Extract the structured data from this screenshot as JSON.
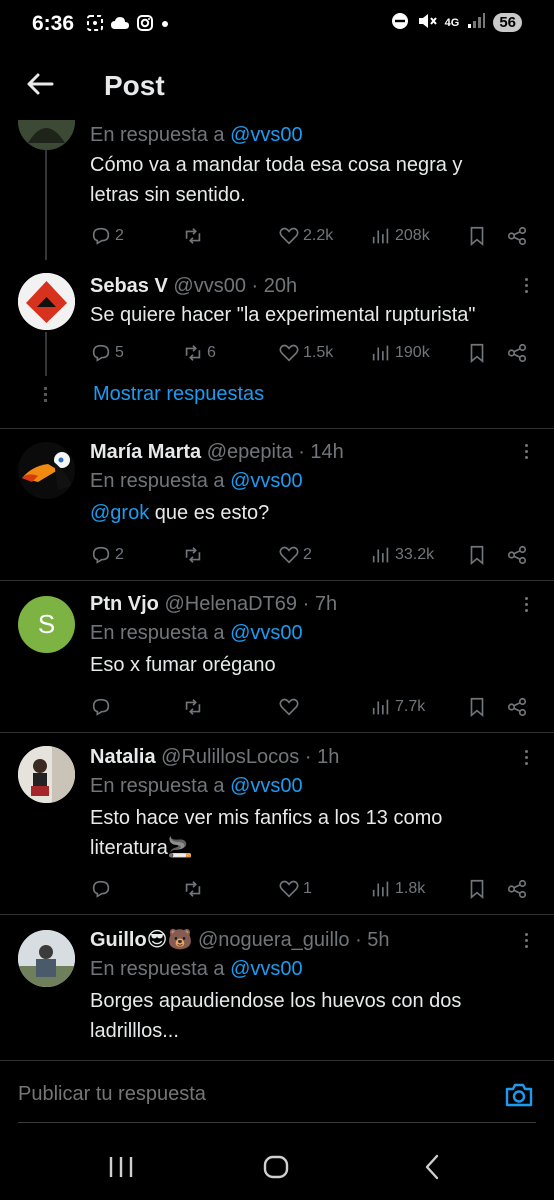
{
  "status_bar": {
    "time": "6:36",
    "network": "4G",
    "battery": "56"
  },
  "header": {
    "title": "Post"
  },
  "colors": {
    "background": "#000000",
    "text": "#e7e9ea",
    "muted": "#71767b",
    "accent": "#1d9bf0"
  },
  "tweets": [
    {
      "name": "",
      "handle": "",
      "time": "",
      "reply_prefix": "En respuesta a",
      "reply_to": "@vvs00",
      "text_lines": [
        "Cómo va a mandar toda esa cosa negra y",
        "letras sin sentido."
      ],
      "replies": "2",
      "retweets": "",
      "likes": "2.2k",
      "views": "208k"
    },
    {
      "name": "Sebas V",
      "handle": "@vvs00 · 20h",
      "text_lines": [
        "Se quiere hacer \"la experimental rupturista\""
      ],
      "replies": "5",
      "retweets": "6",
      "likes": "1.5k",
      "views": "190k"
    },
    {
      "name": "María Marta",
      "handle": "@epepita · 14h",
      "reply_prefix": "En respuesta a",
      "reply_to": "@vvs00",
      "text_mention": "@grok",
      "text_rest": " que es esto?",
      "replies": "2",
      "retweets": "",
      "likes": "2",
      "views": "33.2k"
    },
    {
      "name": "Ptn Vjo",
      "handle": "@HelenaDT69 · 7h",
      "avatar_letter": "S",
      "reply_prefix": "En respuesta a",
      "reply_to": "@vvs00",
      "text_lines": [
        "Eso x fumar orégano"
      ],
      "replies": "",
      "retweets": "",
      "likes": "",
      "views": "7.7k"
    },
    {
      "name": "Natalia",
      "handle": "@RulillosLocos · 1h",
      "reply_prefix": "En respuesta a",
      "reply_to": "@vvs00",
      "text_lines": [
        "Esto hace ver mis fanfics a los 13 como",
        "literatura🚬"
      ],
      "replies": "",
      "retweets": "",
      "likes": "1",
      "views": "1.8k"
    },
    {
      "name": "Guillo😎🐻",
      "handle": "@noguera_guillo · 5h",
      "reply_prefix": "En respuesta a",
      "reply_to": "@vvs00",
      "text_lines": [
        "Borges apaudiendose los huevos con dos",
        "ladrilllos..."
      ]
    }
  ],
  "show_replies_label": "Mostrar respuestas",
  "composer": {
    "placeholder": "Publicar tu respuesta"
  }
}
